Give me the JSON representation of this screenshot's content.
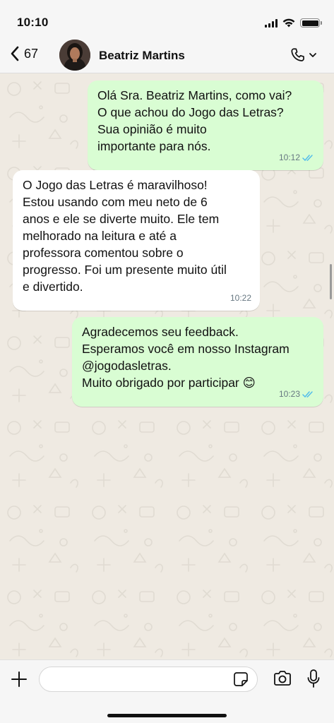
{
  "status_bar": {
    "time": "10:10"
  },
  "header": {
    "back_count": "67",
    "contact_name": "Beatriz Martins"
  },
  "messages": [
    {
      "direction": "outgoing",
      "text": "Olá Sra. Beatriz Martins, como vai?\nO que achou do Jogo das Letras?\nSua opinião é muito\nimportante para nós.",
      "time": "10:12",
      "read": true
    },
    {
      "direction": "incoming",
      "text": "O Jogo das Letras é maravilhoso!\nEstou usando com meu neto de 6\nanos e ele se diverte muito. Ele tem\nmelhorado na leitura e até a\nprofessora comentou sobre o\nprogresso. Foi um presente muito útil\ne divertido.",
      "time": "10:22"
    },
    {
      "direction": "outgoing",
      "text": "Agradecemos seu feedback.\nEsperamos você em nosso Instagram\n@jogodasletras.\nMuito obrigado por participar 😊",
      "time": "10:23",
      "read": true
    }
  ],
  "input": {
    "value": "",
    "placeholder": ""
  },
  "colors": {
    "outgoing_bubble": "#d9fdd3",
    "incoming_bubble": "#ffffff",
    "wallpaper": "#efeae2",
    "read_ticks": "#53bdeb"
  },
  "icons": [
    "back-chevron-icon",
    "avatar-photo",
    "phone-icon",
    "chevron-down-icon",
    "plus-icon",
    "sticker-icon",
    "camera-icon",
    "microphone-icon",
    "double-check-icon"
  ]
}
